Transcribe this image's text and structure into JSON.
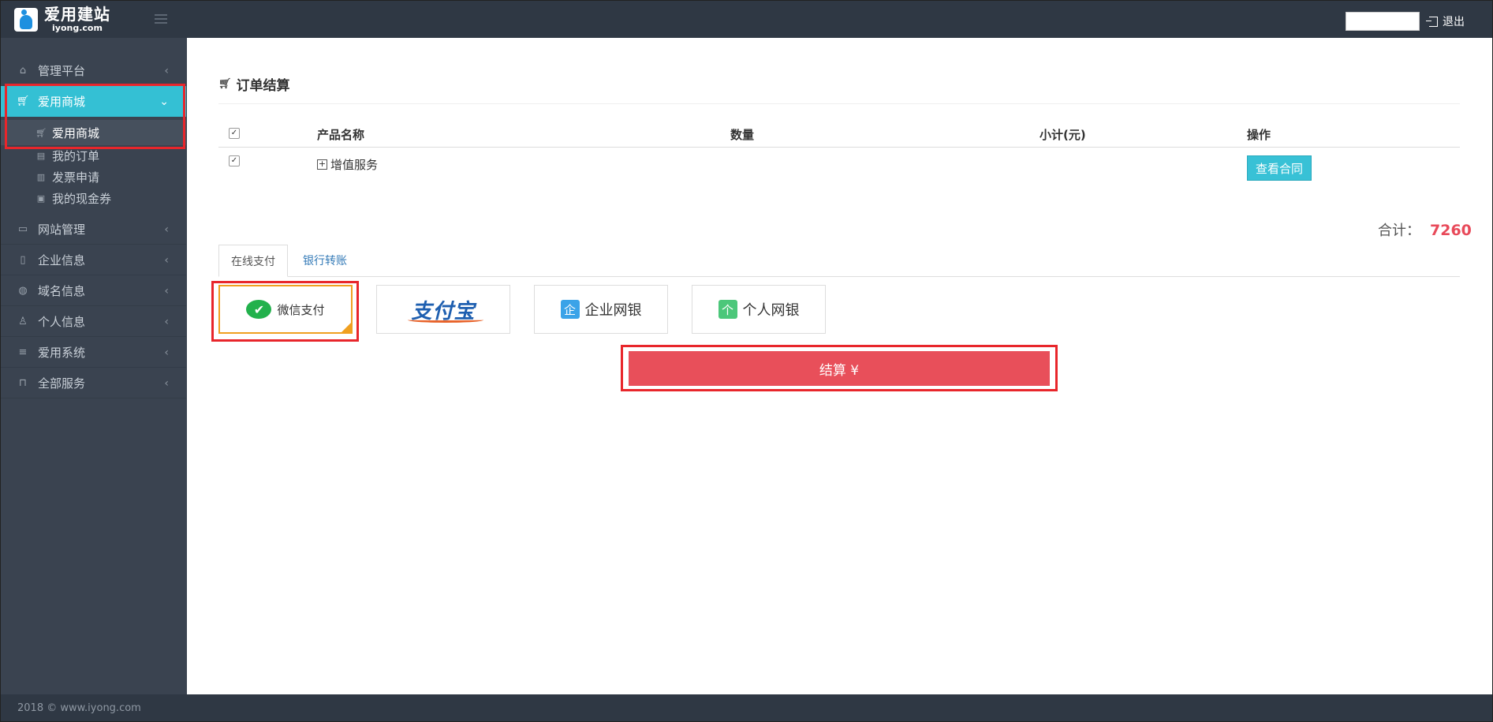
{
  "header": {
    "logo_cn": "爱用建站",
    "logo_en": "iyong.com",
    "logout_label": "退出"
  },
  "sidebar": {
    "items": [
      {
        "label": "管理平台",
        "icon": "home-icon"
      },
      {
        "label": "爱用商城",
        "icon": "cart-icon",
        "active": true
      },
      {
        "label": "网站管理",
        "icon": "laptop-icon"
      },
      {
        "label": "企业信息",
        "icon": "building-icon"
      },
      {
        "label": "域名信息",
        "icon": "globe-icon"
      },
      {
        "label": "个人信息",
        "icon": "user-icon"
      },
      {
        "label": "爱用系统",
        "icon": "list-icon"
      },
      {
        "label": "全部服务",
        "icon": "bag-icon"
      }
    ],
    "submenu": [
      {
        "label": "爱用商城",
        "icon": "cart-icon",
        "selected": true
      },
      {
        "label": "我的订单",
        "icon": "doc-icon"
      },
      {
        "label": "发票申请",
        "icon": "barcode-icon"
      },
      {
        "label": "我的现金券",
        "icon": "money-icon"
      }
    ]
  },
  "order": {
    "title": "订单结算",
    "columns": [
      "产品名称",
      "数量",
      "小计(元)",
      "操作"
    ],
    "rows": [
      {
        "product": "增值服务",
        "quantity": "",
        "subtotal": "",
        "action": "查看合同"
      }
    ],
    "total_label": "合计：",
    "total_value": "7260"
  },
  "payment": {
    "tabs": [
      "在线支付",
      "银行转账"
    ],
    "methods": [
      {
        "label": "微信支付"
      },
      {
        "label": "支付宝"
      },
      {
        "label": "企业网银",
        "badge": "企"
      },
      {
        "label": "个人网银",
        "badge": "个"
      }
    ],
    "checkout_label": "结算 ¥"
  },
  "footer": {
    "copyright": "2018 © www.iyong.com"
  },
  "colors": {
    "accent": "#34c0d4",
    "checkout": "#e84f5a",
    "total": "#e84a5a",
    "highlight": "#e8262b"
  }
}
